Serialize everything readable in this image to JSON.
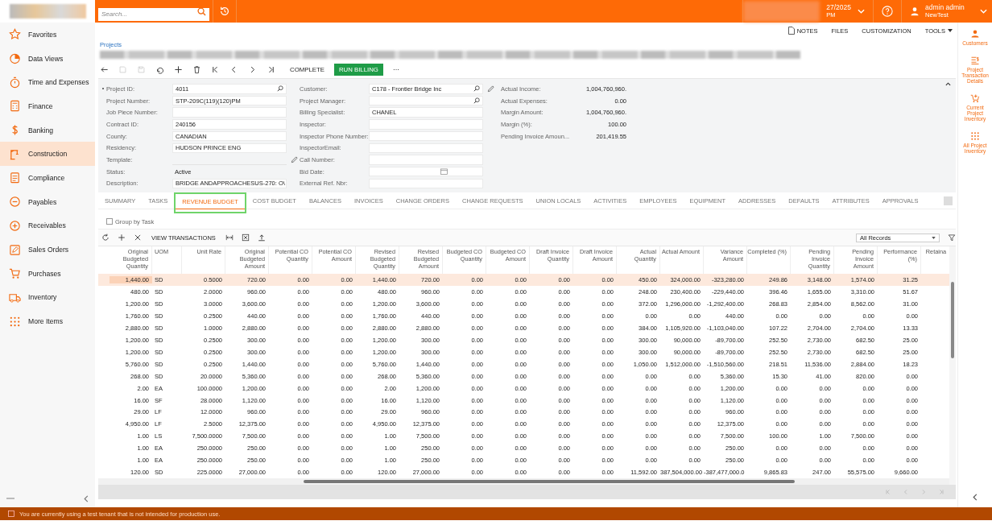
{
  "top_bar": {
    "search": {
      "placeholder": "Search..."
    },
    "date": "27/2025",
    "time": "PM",
    "user": {
      "name": "admin admin",
      "tenant": "NewTest"
    }
  },
  "sidebar": {
    "items": [
      {
        "label": "Favorites",
        "selected": false
      },
      {
        "label": "Data Views",
        "selected": false
      },
      {
        "label": "Time and Expenses",
        "selected": false
      },
      {
        "label": "Finance",
        "selected": false
      },
      {
        "label": "Banking",
        "selected": false
      },
      {
        "label": "Construction",
        "selected": true
      },
      {
        "label": "Compliance",
        "selected": false
      },
      {
        "label": "Payables",
        "selected": false
      },
      {
        "label": "Receivables",
        "selected": false
      },
      {
        "label": "Sales Orders",
        "selected": false
      },
      {
        "label": "Purchases",
        "selected": false
      },
      {
        "label": "Inventory",
        "selected": false
      },
      {
        "label": "More Items",
        "selected": false
      }
    ]
  },
  "page_links": [
    "NOTES",
    "FILES",
    "CUSTOMIZATION",
    "TOOLS"
  ],
  "breadcrumb": "Projects",
  "toolbar": {
    "complete": "COMPLETE",
    "run_billing": "RUN BILLING",
    "more": "⋯"
  },
  "form": {
    "left": [
      {
        "label": "Project ID:",
        "value": "4011",
        "kind": "lookup",
        "required": true
      },
      {
        "label": "Project Number:",
        "value": "STP-209C(119)(120)PM",
        "kind": "text",
        "required": false
      },
      {
        "label": "Job Piece Number:",
        "kind": "text",
        "required": false
      },
      {
        "label": "Contract ID:",
        "value": "240156",
        "kind": "text",
        "required": false
      },
      {
        "label": "County:",
        "value": "CANADIAN",
        "kind": "text",
        "required": false
      },
      {
        "label": "Residency:",
        "value": "HUDSON PRINCE ENG",
        "kind": "text",
        "required": false
      },
      {
        "label": "Template:",
        "kind": "edit",
        "required": false
      },
      {
        "label": "Status:",
        "value": "Active",
        "kind": "plain",
        "required": false
      },
      {
        "label": "Description:",
        "value": "BRIDGE ANDAPPROACHESUS-270: O\\",
        "kind": "text",
        "required": false
      }
    ],
    "middle": [
      {
        "label": "Customer:",
        "value": "C178 - Frontier Bridge Inc",
        "kind": "lookup-edit",
        "required": false
      },
      {
        "label": "Project Manager:",
        "kind": "lookup",
        "required": false
      },
      {
        "label": "Billing Specialist:",
        "value": "CHANEL",
        "kind": "text",
        "required": false
      },
      {
        "label": "Inspector:",
        "kind": "text",
        "required": false
      },
      {
        "label": "Inspector Phone Number:",
        "kind": "text",
        "required": false
      },
      {
        "label": "InspectorEmail:",
        "kind": "text",
        "required": false
      },
      {
        "label": "Call Number:",
        "kind": "text",
        "required": false
      },
      {
        "label": "Bid Date:",
        "kind": "date",
        "required": false
      },
      {
        "label": "External Ref. Nbr:",
        "kind": "text",
        "required": false
      }
    ],
    "summary": [
      {
        "label": "Actual Income:",
        "value": "1,004,760,960."
      },
      {
        "label": "Actual Expenses:",
        "value": "0.00"
      },
      {
        "label": "Margin Amount:",
        "value": "1,004,760,960."
      },
      {
        "label": "Margin (%):",
        "value": "100.00"
      },
      {
        "label": "Pending Invoice Amoun...",
        "value": "201,419.55"
      }
    ]
  },
  "tabs": [
    {
      "label": "SUMMARY",
      "selected": false
    },
    {
      "label": "TASKS",
      "selected": false
    },
    {
      "label": "REVENUE BUDGET",
      "selected": true
    },
    {
      "label": "COST BUDGET",
      "selected": false
    },
    {
      "label": "BALANCES",
      "selected": false
    },
    {
      "label": "INVOICES",
      "selected": false
    },
    {
      "label": "CHANGE ORDERS",
      "selected": false
    },
    {
      "label": "CHANGE REQUESTS",
      "selected": false
    },
    {
      "label": "UNION LOCALS",
      "selected": false
    },
    {
      "label": "ACTIVITIES",
      "selected": false
    },
    {
      "label": "EMPLOYEES",
      "selected": false
    },
    {
      "label": "EQUIPMENT",
      "selected": false
    },
    {
      "label": "ADDRESSES",
      "selected": false
    },
    {
      "label": "DEFAULTS",
      "selected": false
    },
    {
      "label": "ATTRIBUTES",
      "selected": false
    },
    {
      "label": "APPROVALS",
      "selected": false
    }
  ],
  "group_by_task": {
    "label": "Group by Task",
    "checked": false
  },
  "grid_toolbar": {
    "view_transactions": "VIEW TRANSACTIONS",
    "filter": "All Records"
  },
  "table": {
    "columns": [
      "Original Budgeted Quantity",
      "UOM",
      "Unit Rate",
      "Original Budgeted Amount",
      "Potential CO Quantity",
      "Potential CO Amount",
      "Revised Budgeted Quantity",
      "Revised Budgeted Amount",
      "Budgeted CO Quantity",
      "Budgeted CO Amount",
      "Draft Invoice Quantity",
      "Draft Invoice Amount",
      "Actual Quantity",
      "Actual Amount",
      "Variance Amount",
      "Completed (%)",
      "Pending Invoice Quantity",
      "Pending Invoice Amount",
      "Performance (%)",
      "Retaina"
    ],
    "rows": [
      {
        "selected": true,
        "cells": [
          "1,440.00",
          "SD",
          "0.5000",
          "720.00",
          "0.00",
          "0.00",
          "1,440.00",
          "720.00",
          "0.00",
          "0.00",
          "0.00",
          "0.00",
          "450.00",
          "324,000.00",
          "-323,280.00",
          "249.86",
          "3,148.00",
          "1,574.00",
          "31.25"
        ]
      },
      {
        "selected": false,
        "cells": [
          "480.00",
          "SD",
          "2.0000",
          "960.00",
          "0.00",
          "0.00",
          "480.00",
          "960.00",
          "0.00",
          "0.00",
          "0.00",
          "0.00",
          "248.00",
          "230,400.00",
          "-229,440.00",
          "396.46",
          "1,655.00",
          "3,310.00",
          "51.67"
        ]
      },
      {
        "selected": false,
        "cells": [
          "1,200.00",
          "SD",
          "3.0000",
          "3,600.00",
          "0.00",
          "0.00",
          "1,200.00",
          "3,600.00",
          "0.00",
          "0.00",
          "0.00",
          "0.00",
          "372.00",
          "1,296,000.00",
          "-1,292,400.00",
          "268.83",
          "2,854.00",
          "8,562.00",
          "31.00"
        ]
      },
      {
        "selected": false,
        "cells": [
          "1,760.00",
          "SD",
          "0.2500",
          "440.00",
          "0.00",
          "0.00",
          "1,760.00",
          "440.00",
          "0.00",
          "0.00",
          "0.00",
          "0.00",
          "0.00",
          "0.00",
          "440.00",
          "0.00",
          "0.00",
          "0.00",
          "0.00"
        ]
      },
      {
        "selected": false,
        "cells": [
          "2,880.00",
          "SD",
          "1.0000",
          "2,880.00",
          "0.00",
          "0.00",
          "2,880.00",
          "2,880.00",
          "0.00",
          "0.00",
          "0.00",
          "0.00",
          "384.00",
          "1,105,920.00",
          "-1,103,040.00",
          "107.22",
          "2,704.00",
          "2,704.00",
          "13.33"
        ]
      },
      {
        "selected": false,
        "cells": [
          "1,200.00",
          "SD",
          "0.2500",
          "300.00",
          "0.00",
          "0.00",
          "1,200.00",
          "300.00",
          "0.00",
          "0.00",
          "0.00",
          "0.00",
          "300.00",
          "90,000.00",
          "-89,700.00",
          "252.50",
          "2,730.00",
          "682.50",
          "25.00"
        ]
      },
      {
        "selected": false,
        "cells": [
          "1,200.00",
          "SD",
          "0.2500",
          "300.00",
          "0.00",
          "0.00",
          "1,200.00",
          "300.00",
          "0.00",
          "0.00",
          "0.00",
          "0.00",
          "300.00",
          "90,000.00",
          "-89,700.00",
          "252.50",
          "2,730.00",
          "682.50",
          "25.00"
        ]
      },
      {
        "selected": false,
        "cells": [
          "5,760.00",
          "SD",
          "0.2500",
          "1,440.00",
          "0.00",
          "0.00",
          "5,760.00",
          "1,440.00",
          "0.00",
          "0.00",
          "0.00",
          "0.00",
          "1,050.00",
          "1,512,000.00",
          "-1,510,560.00",
          "218.51",
          "11,536.00",
          "2,884.00",
          "18.23"
        ]
      },
      {
        "selected": false,
        "cells": [
          "268.00",
          "SD",
          "20.0000",
          "5,360.00",
          "0.00",
          "0.00",
          "268.00",
          "5,360.00",
          "0.00",
          "0.00",
          "0.00",
          "0.00",
          "0.00",
          "0.00",
          "5,360.00",
          "15.30",
          "41.00",
          "820.00",
          "0.00"
        ]
      },
      {
        "selected": false,
        "cells": [
          "2.00",
          "EA",
          "100.0000",
          "1,200.00",
          "0.00",
          "0.00",
          "2.00",
          "1,200.00",
          "0.00",
          "0.00",
          "0.00",
          "0.00",
          "0.00",
          "0.00",
          "1,200.00",
          "0.00",
          "0.00",
          "0.00",
          "0.00"
        ]
      },
      {
        "selected": false,
        "cells": [
          "16.00",
          "SF",
          "28.0000",
          "1,120.00",
          "0.00",
          "0.00",
          "16.00",
          "1,120.00",
          "0.00",
          "0.00",
          "0.00",
          "0.00",
          "0.00",
          "0.00",
          "1,120.00",
          "0.00",
          "0.00",
          "0.00",
          "0.00"
        ]
      },
      {
        "selected": false,
        "cells": [
          "29.00",
          "LF",
          "12.0000",
          "960.00",
          "0.00",
          "0.00",
          "29.00",
          "960.00",
          "0.00",
          "0.00",
          "0.00",
          "0.00",
          "0.00",
          "0.00",
          "960.00",
          "0.00",
          "0.00",
          "0.00",
          "0.00"
        ]
      },
      {
        "selected": false,
        "cells": [
          "4,950.00",
          "LF",
          "2.5000",
          "12,375.00",
          "0.00",
          "0.00",
          "4,950.00",
          "12,375.00",
          "0.00",
          "0.00",
          "0.00",
          "0.00",
          "0.00",
          "0.00",
          "12,375.00",
          "0.00",
          "0.00",
          "0.00",
          "0.00"
        ]
      },
      {
        "selected": false,
        "cells": [
          "1.00",
          "LS",
          "7,500.0000",
          "7,500.00",
          "0.00",
          "0.00",
          "1.00",
          "7,500.00",
          "0.00",
          "0.00",
          "0.00",
          "0.00",
          "0.00",
          "0.00",
          "7,500.00",
          "100.00",
          "1.00",
          "7,500.00",
          "0.00"
        ]
      },
      {
        "selected": false,
        "cells": [
          "1.00",
          "EA",
          "250.0000",
          "250.00",
          "0.00",
          "0.00",
          "1.00",
          "250.00",
          "0.00",
          "0.00",
          "0.00",
          "0.00",
          "0.00",
          "0.00",
          "250.00",
          "0.00",
          "0.00",
          "0.00",
          "0.00"
        ]
      },
      {
        "selected": false,
        "cells": [
          "1.00",
          "EA",
          "250.0000",
          "250.00",
          "0.00",
          "0.00",
          "1.00",
          "250.00",
          "0.00",
          "0.00",
          "0.00",
          "0.00",
          "0.00",
          "0.00",
          "250.00",
          "0.00",
          "0.00",
          "0.00",
          "0.00"
        ]
      },
      {
        "selected": false,
        "cells": [
          "120.00",
          "SD",
          "225.0000",
          "27,000.00",
          "0.00",
          "0.00",
          "120.00",
          "27,000.00",
          "0.00",
          "0.00",
          "0.00",
          "0.00",
          "11,592.00",
          "387,504,000.00",
          "-387,477,000.0",
          "9,865.83",
          "247.00",
          "55,575.00",
          "9,660.00"
        ]
      }
    ]
  },
  "right_rail": [
    {
      "label": "Customers"
    },
    {
      "label": "Project Transaction Details"
    },
    {
      "label": "Current Project Inventory"
    },
    {
      "label": "All Project Inventory"
    }
  ],
  "footer": "You are currently using a test tenant that is not intended for production use."
}
